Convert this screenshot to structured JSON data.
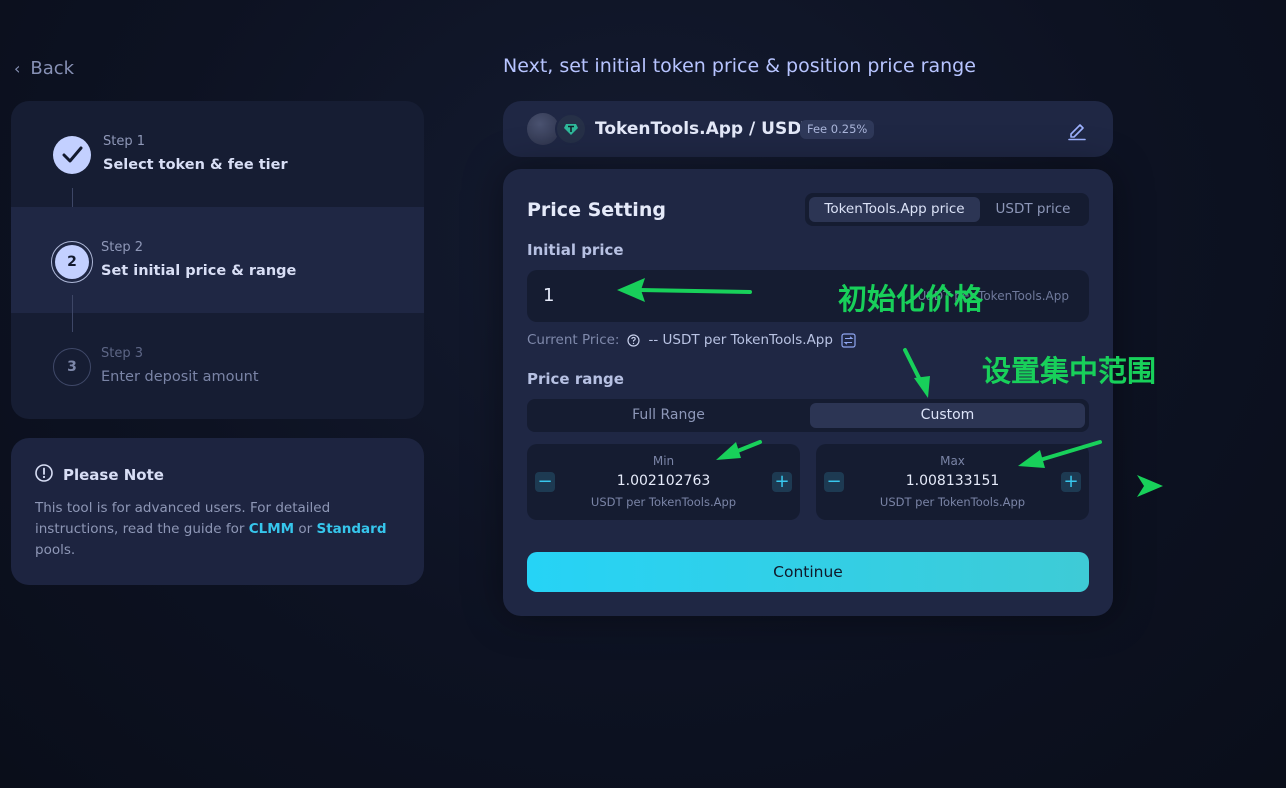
{
  "nav": {
    "back_label": "Back"
  },
  "steps": [
    {
      "label": "Step 1",
      "title": "Select token & fee tier"
    },
    {
      "label": "Step 2",
      "title": "Set initial price & range",
      "number": "2"
    },
    {
      "label": "Step 3",
      "title": "Enter deposit amount",
      "number": "3"
    }
  ],
  "note": {
    "title": "Please Note",
    "body_prefix": "This tool is for advanced users. For detailed instructions, read the guide for ",
    "link_clmm": "CLMM",
    "body_or": " or ",
    "link_standard": "Standard",
    "body_suffix": " pools."
  },
  "heading": "Next, set initial token price & position price range",
  "pair": {
    "name": "TokenTools.App / USDT",
    "fee": "Fee 0.25%"
  },
  "price_setting": {
    "title": "Price Setting",
    "toggle": [
      "TokenTools.App price",
      "USDT price"
    ],
    "initial_label": "Initial price",
    "initial_value": "1",
    "initial_unit": "USDT per TokenTools.App",
    "current_price_label": "Current Price:",
    "current_price_value": "-- USDT per TokenTools.App",
    "range_label": "Price range",
    "range_options": [
      "Full Range",
      "Custom"
    ],
    "min": {
      "label": "Min",
      "value": "1.002102763",
      "unit": "USDT per TokenTools.App"
    },
    "max": {
      "label": "Max",
      "value": "1.008133151",
      "unit": "USDT per TokenTools.App"
    },
    "continue_label": "Continue"
  },
  "annotations": {
    "initial_price": "初始化价格",
    "concentrated_range": "设置集中范围",
    "color": "#18d05a"
  }
}
